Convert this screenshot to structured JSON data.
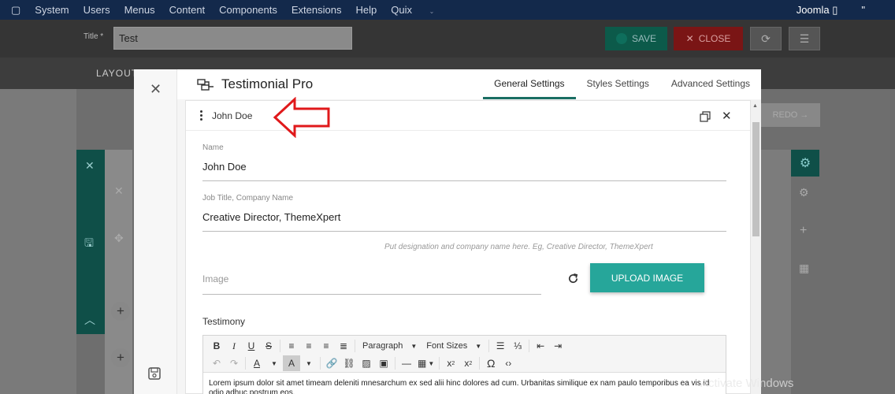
{
  "topbar": {
    "menu": [
      "System",
      "Users",
      "Menus",
      "Content",
      "Components",
      "Extensions",
      "Help",
      "Quix"
    ],
    "site": "Joomla",
    "logo_icon": "joomla-icon"
  },
  "editor_bg": {
    "title_label": "Title *",
    "title_value": "Test",
    "save_label": "SAVE",
    "close_label": "CLOSE",
    "layout_tab": "LAYOUT",
    "redo_label": "REDO"
  },
  "modal": {
    "app_title": "Testimonial Pro",
    "tabs": [
      {
        "label": "General Settings",
        "active": true
      },
      {
        "label": "Styles Settings",
        "active": false
      },
      {
        "label": "Advanced Settings",
        "active": false
      }
    ],
    "item_name": "John Doe",
    "fields": {
      "name_label": "Name",
      "name_value": "John Doe",
      "job_label": "Job Title, Company Name",
      "job_value": "Creative Director, ThemeXpert",
      "job_hint": "Put designation and company name here. Eg, Creative Director, ThemeXpert",
      "image_placeholder": "Image",
      "upload_label": "UPLOAD IMAGE",
      "testimony_label": "Testimony"
    },
    "toolbar": {
      "paragraph": "Paragraph",
      "font_sizes": "Font Sizes"
    },
    "testimony_text": "Lorem ipsum dolor sit amet timeam deleniti mnesarchum ex sed alii hinc dolores ad cum. Urbanitas similique ex nam paulo temporibus ea vis id odio adhuc postrum eos."
  },
  "watermark": "Activate Windows",
  "colors": {
    "accent": "#26a69a",
    "tab_underline": "#1a6e63",
    "annotation": "#e0191b"
  }
}
